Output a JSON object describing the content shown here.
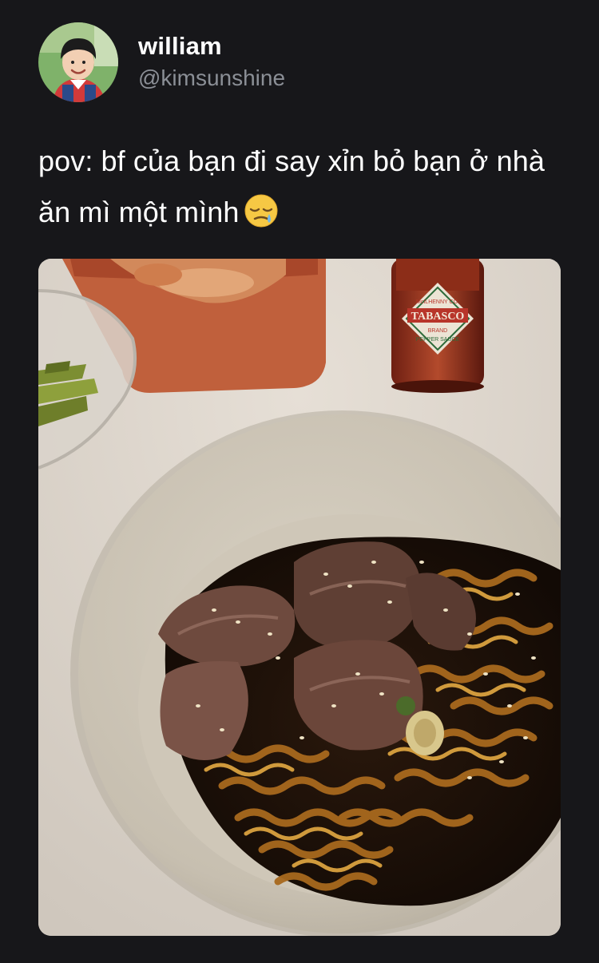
{
  "author": {
    "display_name": "william",
    "handle": "@kimsunshine",
    "avatar_icon": "profile-photo-child"
  },
  "tweet": {
    "text": "pov: bf của bạn đi say xỉn bỏ bạn ở nhà ăn mì một mình",
    "emoji_icon": "sleepy-face-emoji"
  },
  "media": {
    "type": "photo",
    "labels": {
      "bottle_brand": "TABASCO",
      "bottle_maker": "McILHENNY CO.",
      "bottle_sub": "BRAND",
      "bottle_product": "PEPPER SAUCE"
    }
  },
  "colors": {
    "background": "#17171a",
    "text_primary": "#ffffff",
    "text_secondary": "#8b8f96"
  }
}
